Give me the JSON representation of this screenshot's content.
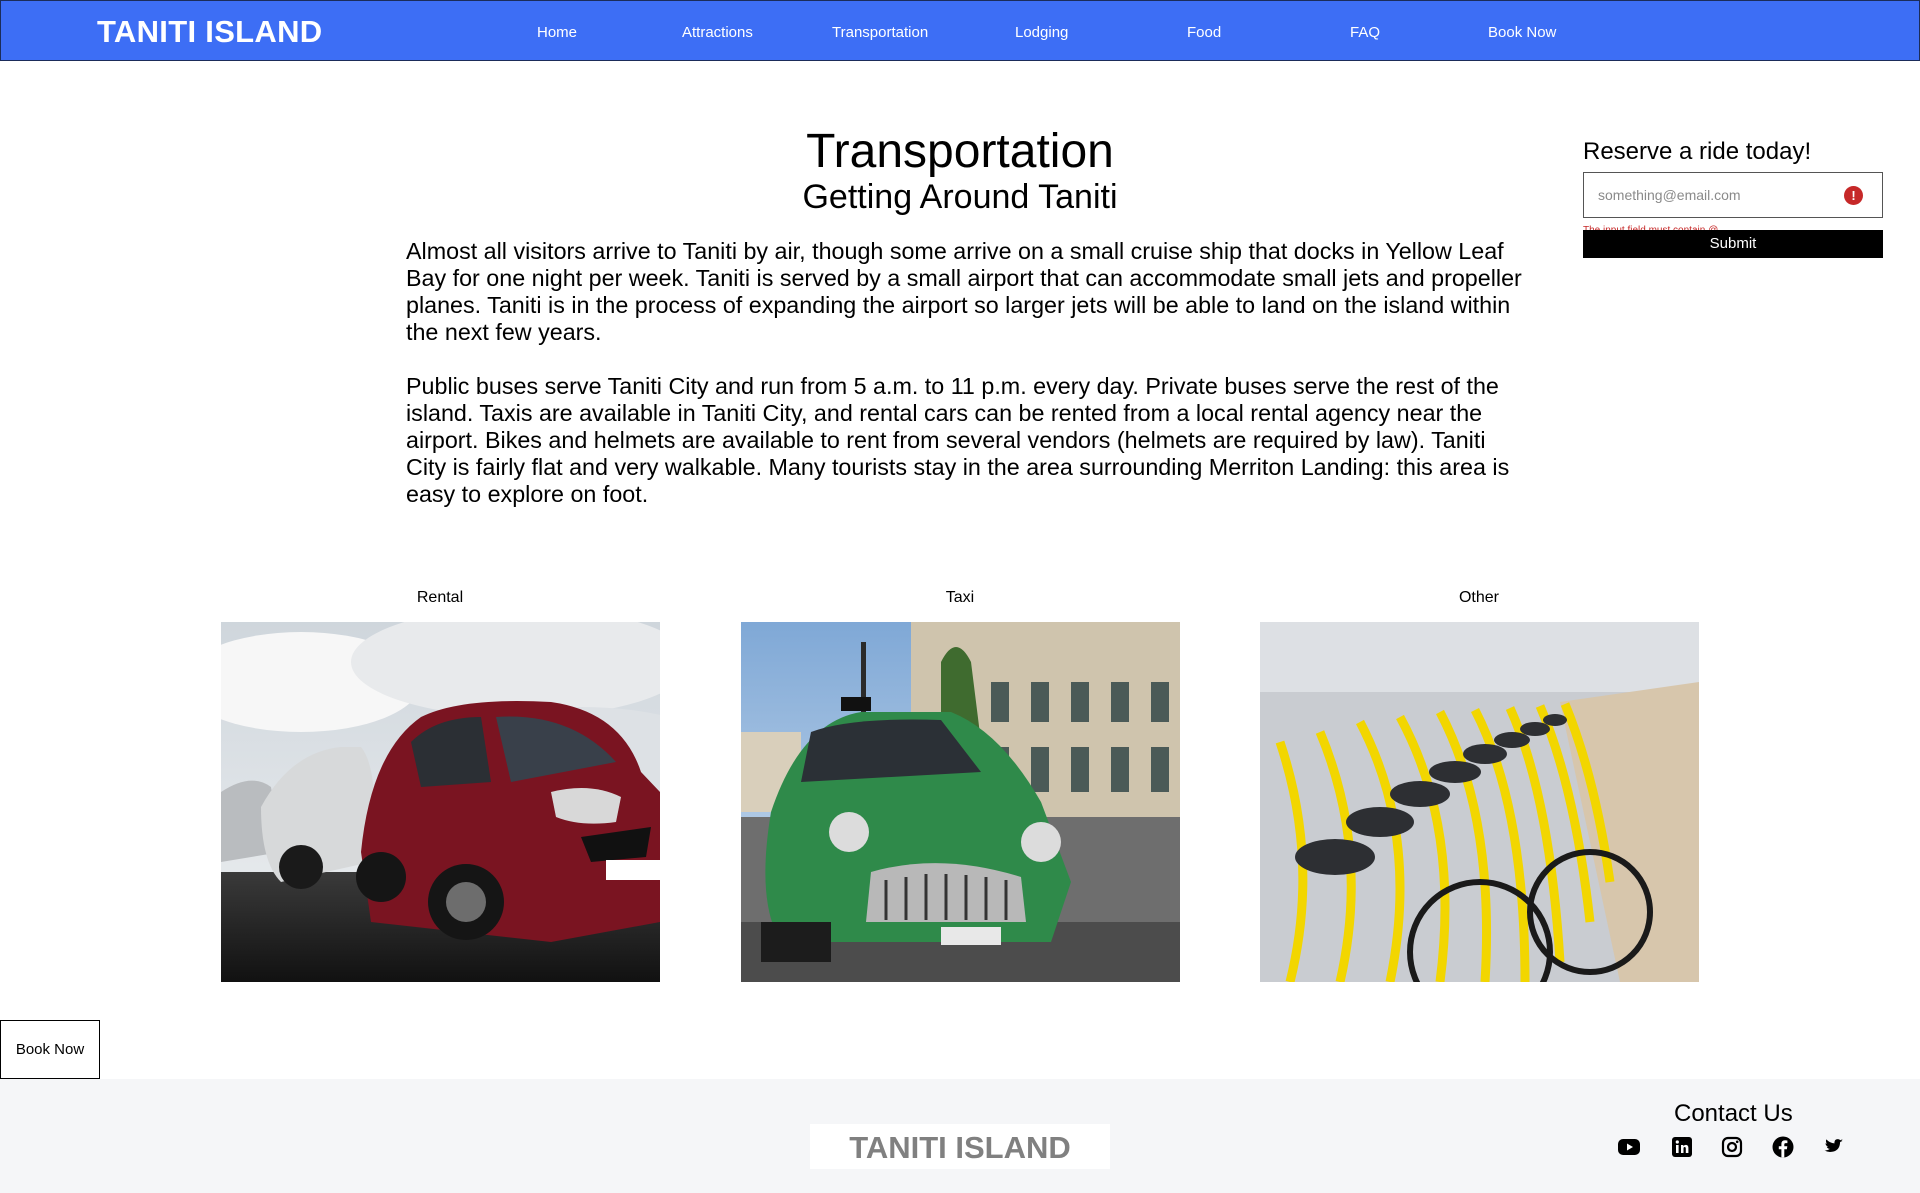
{
  "nav": {
    "brand": "TANITI ISLAND",
    "links": [
      {
        "label": "Home"
      },
      {
        "label": "Attractions"
      },
      {
        "label": "Transportation"
      },
      {
        "label": "Lodging"
      },
      {
        "label": "Food"
      },
      {
        "label": "FAQ"
      },
      {
        "label": "Book Now"
      }
    ]
  },
  "main": {
    "title": "Transportation",
    "subtitle": "Getting Around Taniti",
    "paragraphs": [
      "Almost all visitors arrive to Taniti by air, though some arrive on a small cruise ship that docks in Yellow Leaf Bay for one night per week. Taniti is served by a small airport that can accommodate small jets and propeller planes. Taniti is in the process of expanding the airport so larger jets will be able to land on the island within the next few years.",
      "Public buses serve Taniti City and run from 5 a.m. to 11 p.m. every day. Private buses serve the rest of the island. Taxis are available in Taniti City, and rental cars can be rented from a local rental agency near the airport. Bikes and helmets are available to rent from several vendors (helmets are required by law). Taniti City is fairly flat and very walkable. Many tourists stay in the area surrounding Merriton Landing: this area is easy to explore on foot."
    ]
  },
  "reserve": {
    "title": "Reserve a ride today!",
    "email_placeholder": "something@email.com",
    "error": "The input field must contain @",
    "submit_label": "Submit",
    "alert_glyph": "!"
  },
  "gallery": [
    {
      "label": "Rental",
      "image": "red-car-photo"
    },
    {
      "label": "Taxi",
      "image": "green-taxi-photo"
    },
    {
      "label": "Other",
      "image": "yellow-bikes-photo"
    }
  ],
  "side_button": {
    "label": "Book Now"
  },
  "footer": {
    "brand": "TANITI ISLAND",
    "contact_title": "Contact Us",
    "social": [
      "youtube-icon",
      "linkedin-icon",
      "instagram-icon",
      "facebook-icon",
      "twitter-icon"
    ]
  },
  "colors": {
    "nav_bg": "#3d6ef5",
    "footer_bg": "#f5f6f8",
    "error": "#c62828",
    "submit_bg": "#000000"
  }
}
